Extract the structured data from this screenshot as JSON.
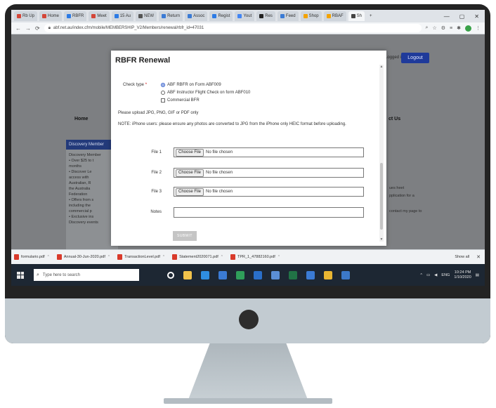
{
  "browser": {
    "tabs": [
      {
        "label": "Rb Up",
        "color": "#d44638"
      },
      {
        "label": "Home",
        "color": "#d44638"
      },
      {
        "label": "RBFR",
        "color": "#2d7be5"
      },
      {
        "label": "Meet",
        "color": "#d44638"
      },
      {
        "label": "15 Au",
        "color": "#2d7be5"
      },
      {
        "label": "NEW",
        "color": "#555555"
      },
      {
        "label": "Return",
        "color": "#3b7bd4"
      },
      {
        "label": "Assoc",
        "color": "#3b7bd4"
      },
      {
        "label": "Regist",
        "color": "#2d7be5"
      },
      {
        "label": "Yout",
        "color": "#4285f4"
      },
      {
        "label": "Res",
        "color": "#222222"
      },
      {
        "label": "Feed",
        "color": "#3b7bd4"
      },
      {
        "label": "Shop",
        "color": "#f4a300"
      },
      {
        "label": "RBAF",
        "color": "#f4a300"
      },
      {
        "label": "Sh",
        "color": "#444444"
      }
    ],
    "url": "abf.net.au/index.cfm/mobile/MEMBERSHIP_V2/Members/renewal/rbfr_id=47031",
    "window_controls": [
      "—",
      "▢",
      "✕"
    ],
    "new_tab": "+"
  },
  "page": {
    "logout_label": "Logout",
    "login_text": "Logged in",
    "nav_left": "Home",
    "nav_right": "ct Us",
    "side_panel_title": "Discovery Member",
    "side_panel_lines": [
      "Discovery Member",
      "• Over $25 to t",
      "  months",
      "• Discover Le",
      "  access with",
      "  Australian, R",
      "  the Australia",
      "  Federation",
      "• Offers from s",
      "  including the",
      "  commercial p",
      "• Exclusive ins",
      "  Discovery events"
    ],
    "right_text_lines": [
      "ues heet",
      "pplication for a",
      "",
      "contact my page to"
    ]
  },
  "modal": {
    "title": "RBFR Renewal",
    "check_type_label": "Check type",
    "required_mark": "*",
    "options": [
      {
        "label": "ABF RBFR on Form ABF009",
        "selected": true,
        "kind": "radio"
      },
      {
        "label": "ABF Instructor Flight Check on form ABF010",
        "selected": false,
        "kind": "radio"
      },
      {
        "label": "Commercial BFR",
        "selected": false,
        "kind": "checkbox"
      }
    ],
    "upload_instruction": "Please upload JPG, PNG, GIF or PDF only",
    "note": "NOTE: iPhone users: please ensure any photos are converted to JPG from the iPhone only HEIC format before uploading.",
    "files": [
      {
        "label": "File 1",
        "button": "Choose File",
        "status": "No file chosen"
      },
      {
        "label": "File 2",
        "button": "Choose File",
        "status": "No file chosen"
      },
      {
        "label": "File 3",
        "button": "Choose File",
        "status": "No file chosen"
      }
    ],
    "notes_label": "Notes",
    "notes_value": "",
    "submit_label": "SUBMIT"
  },
  "downloads": {
    "items": [
      "formulario.pdf",
      "Annual-30-Jun-2020.pdf",
      "TransactionLevel.pdf",
      "Statement2020071.pdf",
      "TPR_1_47882160.pdf"
    ],
    "show_all": "Show all",
    "close": "✕"
  },
  "taskbar": {
    "search_placeholder": "Type here to search",
    "apps": [
      {
        "name": "cortana",
        "color": "#ffffff"
      },
      {
        "name": "file-explorer",
        "color": "#f2c34b"
      },
      {
        "name": "edge",
        "color": "#2f8ee0"
      },
      {
        "name": "maps",
        "color": "#3b7bd4"
      },
      {
        "name": "sheets",
        "color": "#2f9e5a"
      },
      {
        "name": "outlook",
        "color": "#2a6fc9"
      },
      {
        "name": "store",
        "color": "#5b8fd6"
      },
      {
        "name": "excel",
        "color": "#217346"
      },
      {
        "name": "photos",
        "color": "#3b7bd4"
      },
      {
        "name": "chrome",
        "color": "#e9b632"
      },
      {
        "name": "acrobat",
        "color": "#3c79c8"
      }
    ],
    "tray_lang": "ENG",
    "time": "10:24 PM",
    "date": "1/10/2020"
  }
}
